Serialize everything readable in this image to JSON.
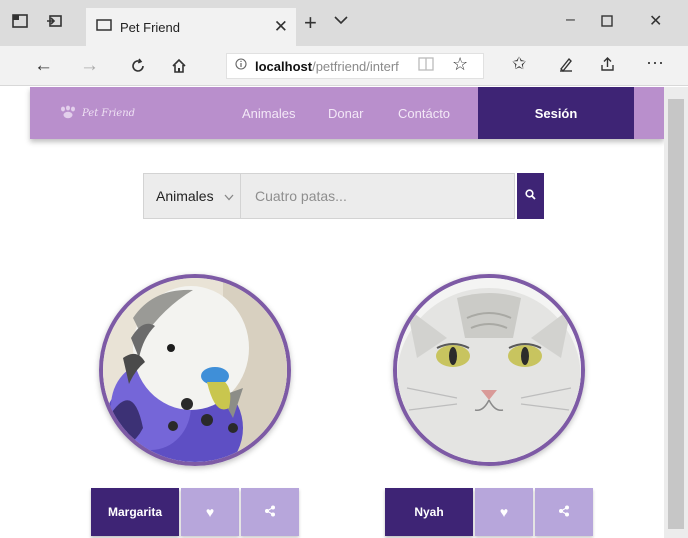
{
  "browser": {
    "tab_title": "Pet Friend",
    "url_host": "localhost",
    "url_path": "/petfriend/interf",
    "icons": [
      "tab-preview-icon",
      "set-aside-tabs-icon",
      "tab-favicon",
      "close-icon",
      "new-tab-icon",
      "tab-list-chevron-icon",
      "back-icon",
      "forward-icon",
      "refresh-icon",
      "home-icon",
      "info-icon",
      "reading-view-icon",
      "favorite-star-icon",
      "favorites-icon",
      "notes-icon",
      "share-icon",
      "more-icon",
      "minimize-icon",
      "maximize-icon",
      "window-close-icon"
    ]
  },
  "site": {
    "logo_text": "Pet Friend",
    "nav": {
      "animales": "Animales",
      "donar": "Donar",
      "contacto": "Contácto",
      "sesion": "Sesión"
    },
    "colors": {
      "nav_bg": "#b98fcc",
      "accent": "#3e2475",
      "secondary": "#b7a6db"
    },
    "search": {
      "category": "Animales",
      "placeholder": "Cuatro patas...",
      "icon": "search-icon"
    },
    "pets": [
      {
        "name": "Margarita",
        "photo": "budgie"
      },
      {
        "name": "Nyah",
        "photo": "cat"
      }
    ]
  }
}
